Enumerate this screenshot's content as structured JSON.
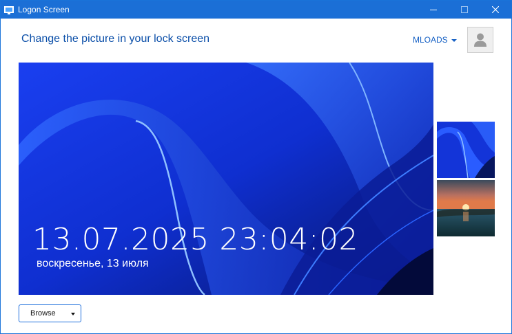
{
  "window": {
    "title": "Logon Screen"
  },
  "header": {
    "heading": "Change the picture in your lock screen",
    "user_name": "MLOADS"
  },
  "preview": {
    "time": "13.07.2025 23:04:02",
    "date": "воскресенье, 13 июля"
  },
  "thumbnails": [
    {
      "name": "blue-bloom-wallpaper"
    },
    {
      "name": "sunset-lake-wallpaper"
    }
  ],
  "actions": {
    "browse_label": "Browse"
  },
  "colors": {
    "titlebar": "#1b6fd6",
    "accent": "#1560c4",
    "heading": "#0a4ea8"
  }
}
